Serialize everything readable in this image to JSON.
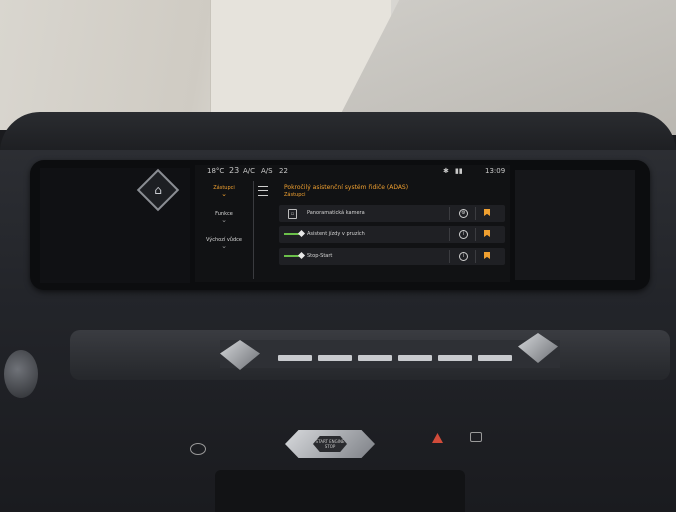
{
  "status_bar": {
    "temp_left": "18°C",
    "temp_set": "23",
    "ac_label": "A/C",
    "auto_label": "A/S",
    "temp_right": "22",
    "time": "13:09"
  },
  "nav": {
    "items": [
      {
        "label": "Zástupci",
        "active": true
      },
      {
        "label": "Funkce",
        "active": false
      },
      {
        "label": "Výchozí vůdce",
        "active": false
      }
    ]
  },
  "header": {
    "title": "Pokročilý asistenční systém řidiče (ADAS)",
    "subtitle": "Zástupci"
  },
  "rows": [
    {
      "label": "Panoramatická kamera",
      "lead": "camera-icon"
    },
    {
      "label": "Asistent jízdy v pruzích",
      "lead": "toggle-on"
    },
    {
      "label": "Stop-Start",
      "lead": "toggle-on"
    }
  ],
  "colors": {
    "accent": "#f0a030",
    "toggle_on": "#6bc04a"
  },
  "start_button": {
    "label": "START ENGINE STOP"
  }
}
